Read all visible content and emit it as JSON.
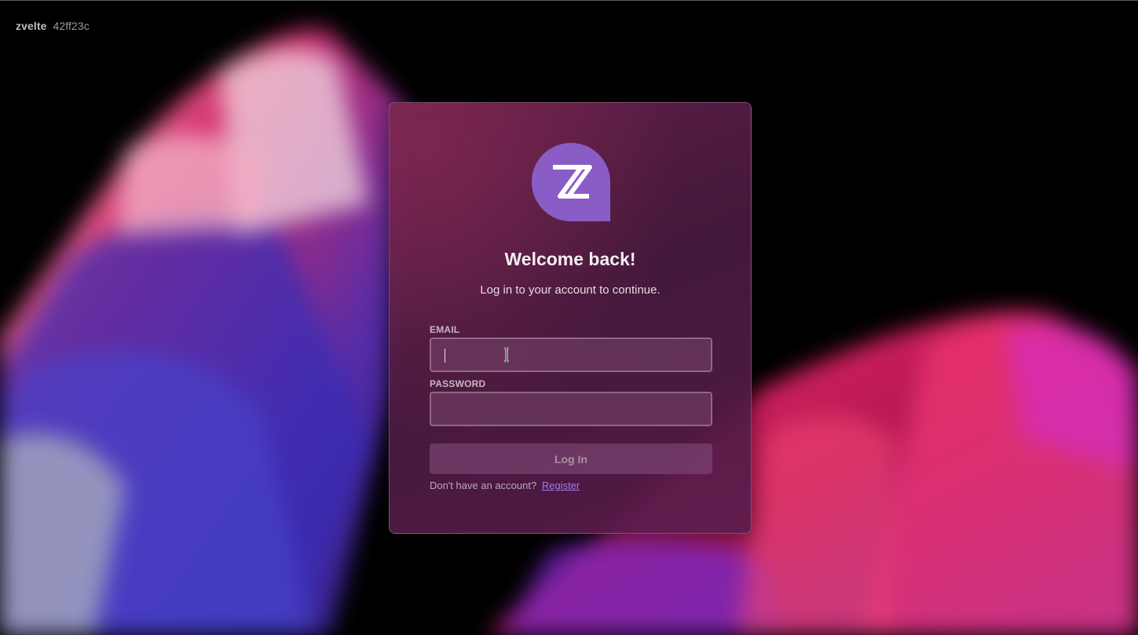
{
  "app": {
    "name": "zvelte",
    "build_hash": "42ff23c"
  },
  "login": {
    "logo_icon": "zvelte-logo-icon",
    "title": "Welcome back!",
    "subtitle": "Log in to your account to continue.",
    "email_label": "EMAIL",
    "email_value": "",
    "password_label": "PASSWORD",
    "password_value": "",
    "login_button_label": "Log In",
    "register_prompt": "Don't have an account?",
    "register_link_label": "Register"
  },
  "colors": {
    "accent": "#8a5cc6",
    "link": "#9c7de6",
    "card_background": "#4b1a40",
    "background": "#000000"
  }
}
